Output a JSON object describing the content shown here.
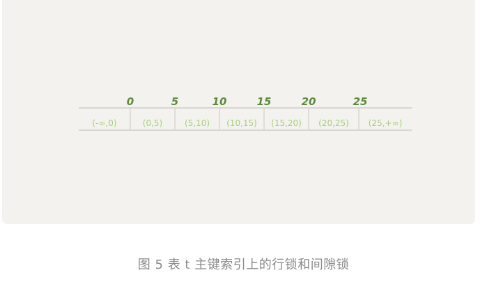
{
  "diagram": {
    "ticks": [
      "0",
      "5",
      "10",
      "15",
      "20",
      "25"
    ],
    "intervals": [
      "(-∞,0)",
      "(0,5)",
      "(5,10)",
      "(10,15)",
      "(15,20)",
      "(20,25)",
      "(25,+∞)"
    ]
  },
  "caption": "图 5 表 t 主键索引上的行锁和间隙锁",
  "colors": {
    "panel_background": "#f3f2ef",
    "tick_text": "#5f8a3e",
    "interval_text": "#a6cf7a",
    "grid_line": "#d6d6d2",
    "caption_text": "#8a8a8a"
  }
}
